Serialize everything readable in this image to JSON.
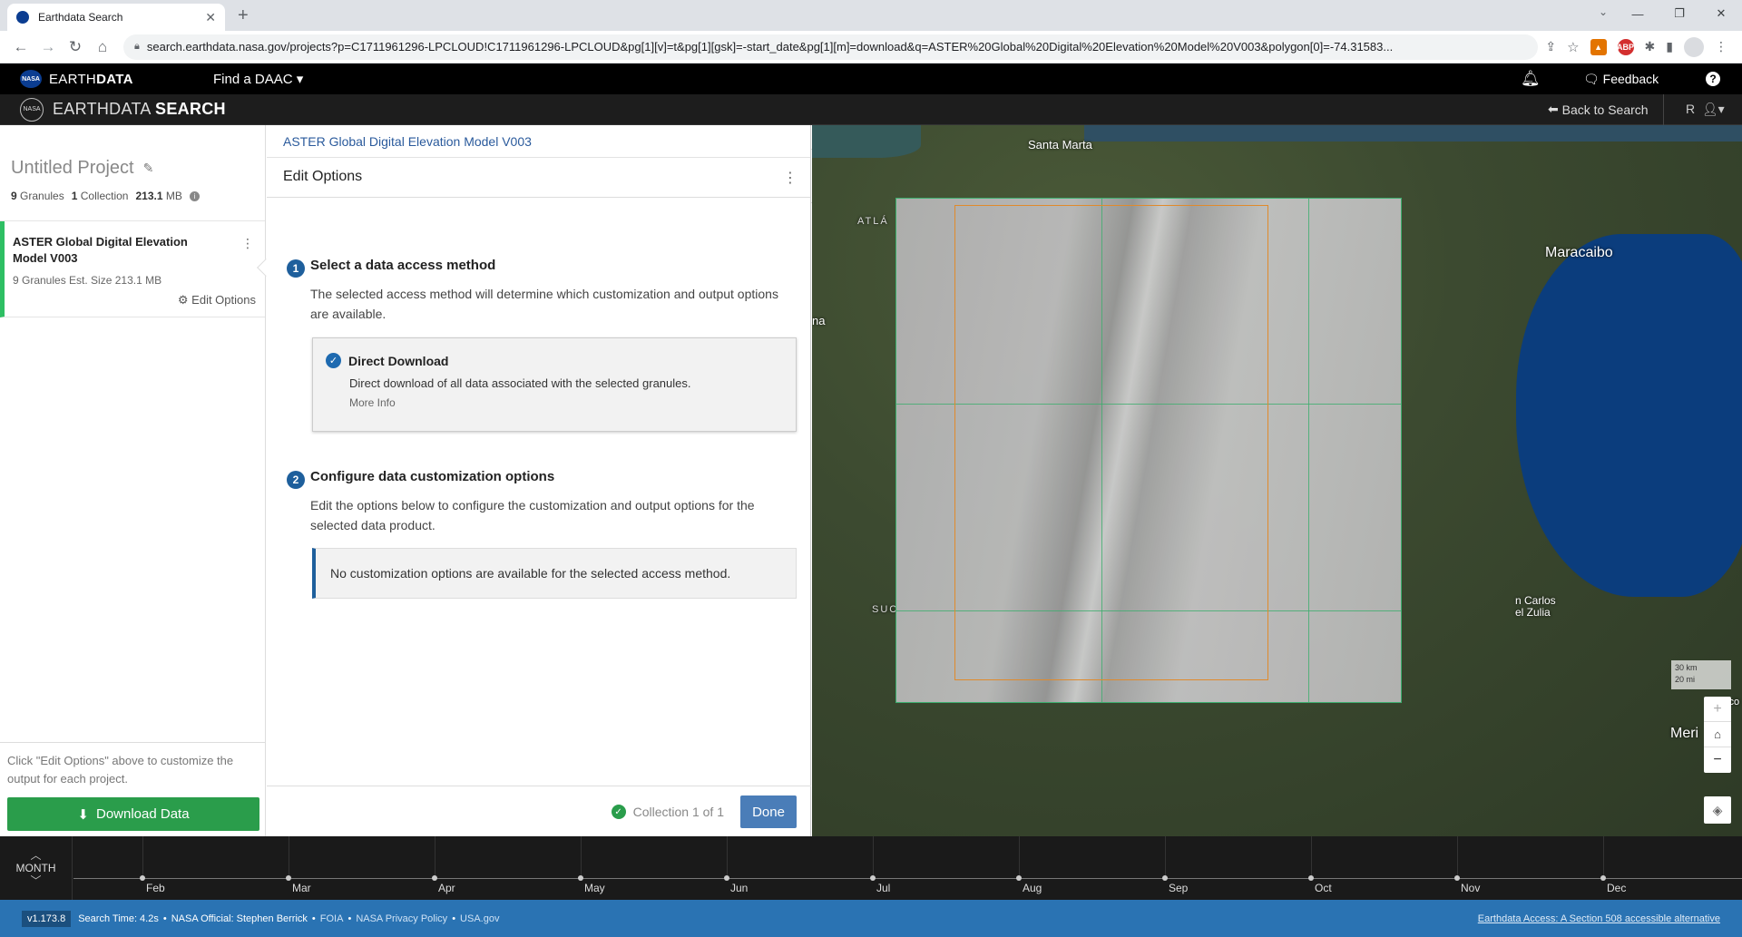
{
  "browser": {
    "tab_title": "Earthdata Search",
    "url": "search.earthdata.nasa.gov/projects?p=C1711961296-LPCLOUD!C1711961296-LPCLOUD&pg[1][v]=t&pg[1][gsk]=-start_date&pg[1][m]=download&q=ASTER%20Global%20Digital%20Elevation%20Model%20V003&polygon[0]=-74.31583..."
  },
  "topbar": {
    "brand_light": "EARTH",
    "brand_bold": "DATA",
    "find_daac": "Find a DAAC ▾",
    "feedback": "Feedback"
  },
  "appbar": {
    "title_light": "EARTHDATA",
    "title_bold": "SEARCH",
    "back_to_search": "Back to Search",
    "user_initial": "R"
  },
  "project": {
    "title": "Untitled Project",
    "granules_count": "9",
    "granules_label": "Granules",
    "collections_count": "1",
    "collections_label": "Collection",
    "size_value": "213.1",
    "size_unit": "MB"
  },
  "collection_item": {
    "name": "ASTER Global Digital Elevation Model V003",
    "meta": "9 Granules   Est. Size 213.1 MB",
    "edit_options": "Edit Options"
  },
  "sidebar_footer": {
    "hint": "Click \"Edit Options\" above to customize the output for each project.",
    "download_button": "Download Data"
  },
  "panel": {
    "breadcrumb": "ASTER Global Digital Elevation Model V003",
    "header": "Edit Options",
    "step1": {
      "number": "1",
      "title": "Select a data access method",
      "desc": "The selected access method will determine which customization and output options are available."
    },
    "access_method": {
      "title": "Direct Download",
      "desc": "Direct download of all data associated with the selected granules.",
      "more": "More Info"
    },
    "step2": {
      "number": "2",
      "title": "Configure data customization options",
      "desc": "Edit the options below to configure the customization and output options for the selected data product."
    },
    "no_custom": "No customization options are available for the selected access method.",
    "collection_count": "Collection 1 of 1",
    "done_button": "Done"
  },
  "map": {
    "labels": {
      "santa_marta": "Santa Marta",
      "maracaibo": "Maracaibo",
      "atlantico": "ATLÁ",
      "na": "na",
      "suc": "SUC",
      "san_carlos": "n Carlos\nel Zulia",
      "merida": "Meri",
      "sco": "sco"
    },
    "scale_km": "30 km",
    "scale_mi": "20 mi",
    "colors": {
      "granule_outline": "#3cb371",
      "selection_outline": "#e08a2b",
      "lake": "#0b3d7d"
    }
  },
  "timeline": {
    "interval": "MONTH",
    "months": [
      "Feb",
      "Mar",
      "Apr",
      "May",
      "Jun",
      "Jul",
      "Aug",
      "Sep",
      "Oct",
      "Nov",
      "Dec"
    ]
  },
  "footer": {
    "version": "v1.173.8",
    "search_time": "Search Time: 4.2s",
    "official": "NASA Official: Stephen Berrick",
    "foia": "FOIA",
    "privacy": "NASA Privacy Policy",
    "usagov": "USA.gov",
    "accessible": "Earthdata Access: A Section 508 accessible alternative"
  }
}
